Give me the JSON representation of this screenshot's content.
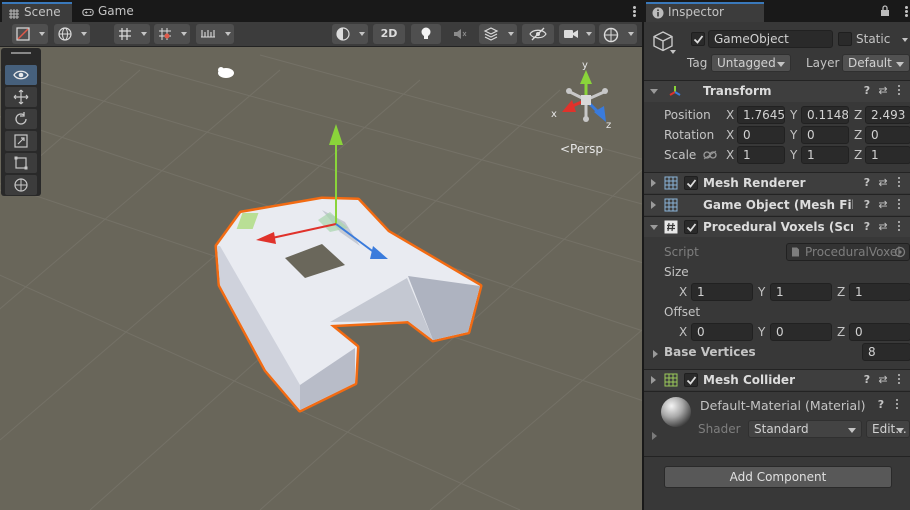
{
  "scene_tabs": {
    "scene": "Scene",
    "game": "Game"
  },
  "toolbar": {
    "two_d_label": "2D"
  },
  "scene_view": {
    "persp_label": "<Persp",
    "gizmo_axes": {
      "x": "x",
      "y": "y",
      "z": "z"
    }
  },
  "inspector": {
    "tab_label": "Inspector",
    "object": {
      "name": "GameObject",
      "static_label": "Static",
      "tag_label": "Tag",
      "tag_value": "Untagged",
      "layer_label": "Layer",
      "layer_value": "Default"
    },
    "transform": {
      "title": "Transform",
      "position": {
        "label": "Position",
        "x": "1.7645",
        "y": "0.1148",
        "z": "2.493"
      },
      "rotation": {
        "label": "Rotation",
        "x": "0",
        "y": "0",
        "z": "0"
      },
      "scale": {
        "label": "Scale",
        "x": "1",
        "y": "1",
        "z": "1"
      }
    },
    "axis_labels": {
      "x": "X",
      "y": "Y",
      "z": "Z"
    },
    "mesh_renderer": {
      "title": "Mesh Renderer"
    },
    "mesh_filter": {
      "title": "Game Object (Mesh Filte"
    },
    "procedural_voxels": {
      "title": "Procedural Voxels (Scrip",
      "script_label": "Script",
      "script_value": "ProceduralVoxel",
      "size_label": "Size",
      "size": {
        "x": "1",
        "y": "1",
        "z": "1"
      },
      "offset_label": "Offset",
      "offset": {
        "x": "0",
        "y": "0",
        "z": "0"
      },
      "base_vertices_label": "Base Vertices",
      "base_vertices_value": "8"
    },
    "mesh_collider": {
      "title": "Mesh Collider"
    },
    "material": {
      "name": "Default-Material (Material)",
      "shader_label": "Shader",
      "shader_value": "Standard",
      "edit_label": "Edit..."
    },
    "add_component_label": "Add Component"
  },
  "colors": {
    "selection_outline": "#f26b13",
    "viewport_bg": "#69665a",
    "axis_x": "#e0322b",
    "axis_y": "#8ad43a",
    "axis_z": "#3a7bdc",
    "accent": "#3a79bb"
  }
}
